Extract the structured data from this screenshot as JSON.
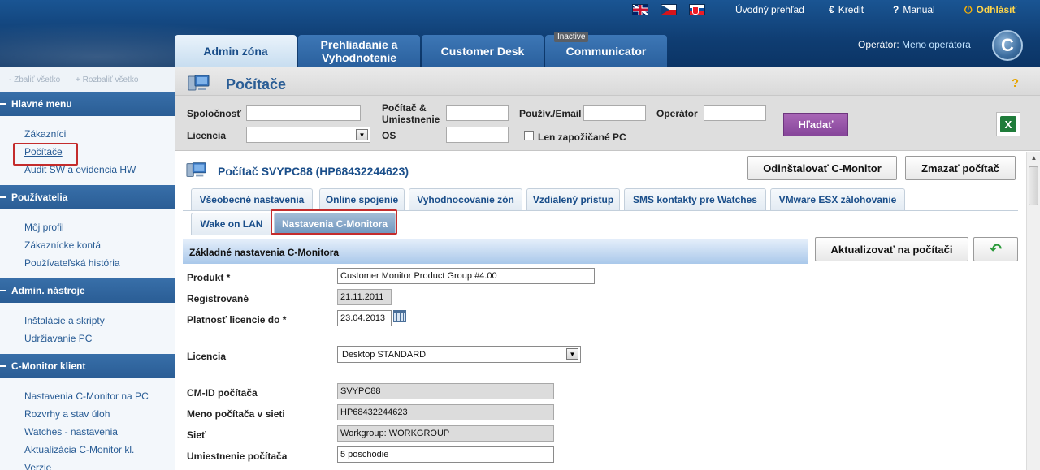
{
  "header": {
    "links": {
      "home": "Úvodný prehľad",
      "credit": "Kredit",
      "manual": "Manual",
      "logout": "Odhlásiť"
    },
    "tabs": {
      "admin": "Admin zóna",
      "review_line1": "Prehliadanie a",
      "review_line2": "Vyhodnotenie",
      "desk": "Customer Desk",
      "communicator": "Communicator",
      "communicator_badge": "Inactive"
    },
    "operator_label": "Operátor:",
    "operator_name": "Meno operátora"
  },
  "sidebar": {
    "collapse_all": "- Zbaliť všetko",
    "expand_all": "+ Rozbaliť všetko",
    "groups": [
      {
        "title": "Hlavné menu",
        "items": [
          "Zákazníci",
          "Počítače",
          "Audit SW a evidencia HW"
        ]
      },
      {
        "title": "Používatelia",
        "items": [
          "Môj profil",
          "Zákaznícke kontá",
          "Používateľská história"
        ]
      },
      {
        "title": "Admin. nástroje",
        "items": [
          "Inštalácie a skripty",
          "Udržiavanie PC"
        ]
      },
      {
        "title": "C-Monitor klient",
        "items": [
          "Nastavenia C-Monitor na PC",
          "Rozvrhy a stav úloh",
          "Watches - nastavenia",
          "Aktualizácia C-Monitor kl.",
          "Verzie"
        ]
      }
    ]
  },
  "page": {
    "title": "Počítače",
    "help": "?"
  },
  "filter": {
    "company": "Spoločnosť",
    "computer_location_1": "Počítač &",
    "computer_location_2": "Umiestnenie",
    "user_email": "Použív./Email",
    "operator": "Operátor",
    "license": "Licencia",
    "os": "OS",
    "lent_only": "Len zapožičané PC",
    "search_button": "Hľadať"
  },
  "detail": {
    "title": "Počítač SVYPC88 (HP68432244623)",
    "uninstall_button": "Odinštalovať C-Monitor",
    "delete_button": "Zmazať počítač",
    "tabs": [
      "Všeobecné nastavenia",
      "Online spojenie",
      "Vyhodnocovanie zón",
      "Vzdialený prístup",
      "SMS kontakty pre Watches",
      "VMware ESX zálohovanie",
      "Wake on LAN",
      "Nastavenia C-Monitora"
    ],
    "section_title": "Základné nastavenia C-Monitora",
    "update_button": "Aktualizovať na počítači",
    "fields": {
      "product_label": "Produkt *",
      "product_value": "Customer Monitor Product Group #4.00",
      "registered_label": "Registrované",
      "registered_value": "21.11.2011",
      "license_valid_label": "Platnosť licencie do *",
      "license_valid_value": "23.04.2013",
      "license_label": "Licencia",
      "license_value": "Desktop STANDARD",
      "cmid_label": "CM-ID počítača",
      "cmid_value": "SVYPC88",
      "netname_label": "Meno počítača v sieti",
      "netname_value": "HP68432244623",
      "network_label": "Sieť",
      "network_value": "Workgroup: WORKGROUP",
      "location_label": "Umiestnenie počítača",
      "location_value": "5 poschodie"
    }
  }
}
